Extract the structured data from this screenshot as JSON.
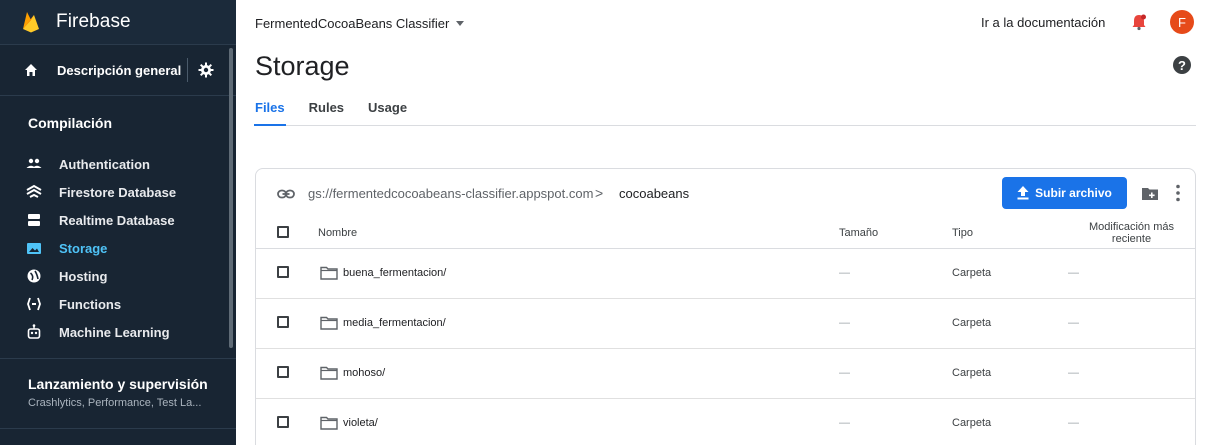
{
  "sidebar": {
    "brand": "Firebase",
    "overview_label": "Descripción general del proyecto",
    "section_title": "Compilación",
    "items": [
      {
        "label": "Authentication",
        "icon": "people-icon"
      },
      {
        "label": "Firestore Database",
        "icon": "firestore-icon"
      },
      {
        "label": "Realtime Database",
        "icon": "database-icon"
      },
      {
        "label": "Storage",
        "icon": "storage-icon",
        "active": true
      },
      {
        "label": "Hosting",
        "icon": "hosting-icon"
      },
      {
        "label": "Functions",
        "icon": "functions-icon"
      },
      {
        "label": "Machine Learning",
        "icon": "robot-icon"
      }
    ],
    "launch_title": "Lanzamiento y supervisión",
    "launch_subtitle": "Crashlytics, Performance, Test La..."
  },
  "topbar": {
    "project_name": "FermentedCocoaBeans Classifier",
    "docs_link": "Ir a la documentación",
    "avatar_letter": "F"
  },
  "page": {
    "title": "Storage",
    "tabs": [
      {
        "label": "Files",
        "active": true
      },
      {
        "label": "Rules"
      },
      {
        "label": "Usage"
      }
    ]
  },
  "storage": {
    "bucket": "gs://fermentedcocoabeans-classifier.appspot.com",
    "separator": ">",
    "current_folder": "cocoabeans",
    "upload_label": "Subir archivo",
    "columns": {
      "name": "Nombre",
      "size": "Tamaño",
      "type": "Tipo",
      "modified": "Modificación más reciente"
    },
    "rows": [
      {
        "name": "buena_fermentacion/",
        "size": "—",
        "type": "Carpeta",
        "modified": "—"
      },
      {
        "name": "media_fermentacion/",
        "size": "—",
        "type": "Carpeta",
        "modified": "—"
      },
      {
        "name": "mohoso/",
        "size": "—",
        "type": "Carpeta",
        "modified": "—"
      },
      {
        "name": "violeta/",
        "size": "—",
        "type": "Carpeta",
        "modified": "—"
      }
    ]
  },
  "colors": {
    "sidebar_bg": "#182533",
    "active_item": "#4fc3f7",
    "primary_blue": "#1a73e8",
    "avatar_bg": "#e64a19"
  }
}
